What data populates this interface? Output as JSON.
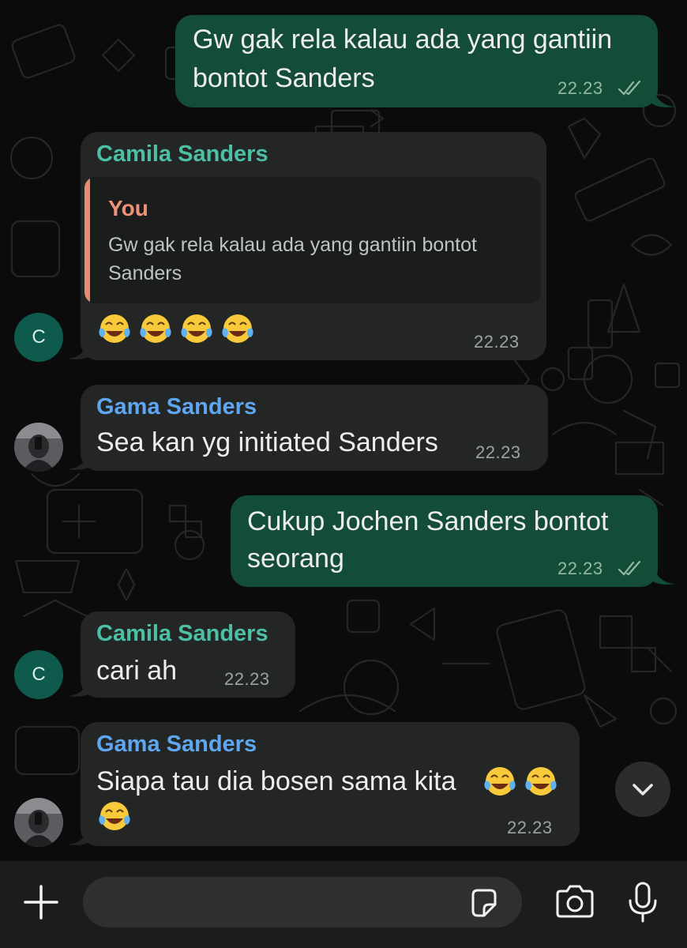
{
  "colors": {
    "background": "#0b0b0b",
    "incoming_bubble": "#242626",
    "outgoing_bubble": "#144d37",
    "sender_teal": "#4cbfa5",
    "sender_blue": "#5ea7f0",
    "quote_accent": "#e98b72"
  },
  "messages": [
    {
      "direction": "outgoing",
      "text_lines": [
        "Gw gak rela kalau ada yang gantiin",
        "bontot Sanders"
      ],
      "time": "22.23",
      "status": "read-double-check"
    },
    {
      "direction": "incoming",
      "sender": "Camila Sanders",
      "reply_to": {
        "author": "You",
        "text": "Gw gak rela kalau ada yang gantiin bontot Sanders"
      },
      "emojis": [
        "face-with-tears-of-joy",
        "face-with-tears-of-joy",
        "face-with-tears-of-joy",
        "face-with-tears-of-joy"
      ],
      "time": "22.23",
      "avatar_letter": "C"
    },
    {
      "direction": "incoming",
      "sender": "Gama Sanders",
      "text": "Sea kan yg initiated Sanders",
      "time": "22.23",
      "avatar": "photo"
    },
    {
      "direction": "outgoing",
      "text_lines": [
        "Cukup Jochen Sanders bontot",
        "seorang"
      ],
      "time": "22.23",
      "status": "read-double-check"
    },
    {
      "direction": "incoming",
      "sender": "Camila Sanders",
      "text": "cari ah",
      "time": "22.23",
      "avatar_letter": "C"
    },
    {
      "direction": "incoming",
      "sender": "Gama Sanders",
      "text": "Siapa tau dia bosen sama kita",
      "emojis": [
        "face-with-tears-of-joy",
        "face-with-tears-of-joy",
        "face-with-tears-of-joy"
      ],
      "time": "22.23",
      "avatar": "photo"
    }
  ],
  "scroll_button": {
    "icon": "chevron-down-icon"
  },
  "composer": {
    "value": "",
    "placeholder": ""
  },
  "bottom_bar": {
    "icons": [
      "plus-icon",
      "sticker-icon",
      "camera-icon",
      "microphone-icon"
    ]
  }
}
